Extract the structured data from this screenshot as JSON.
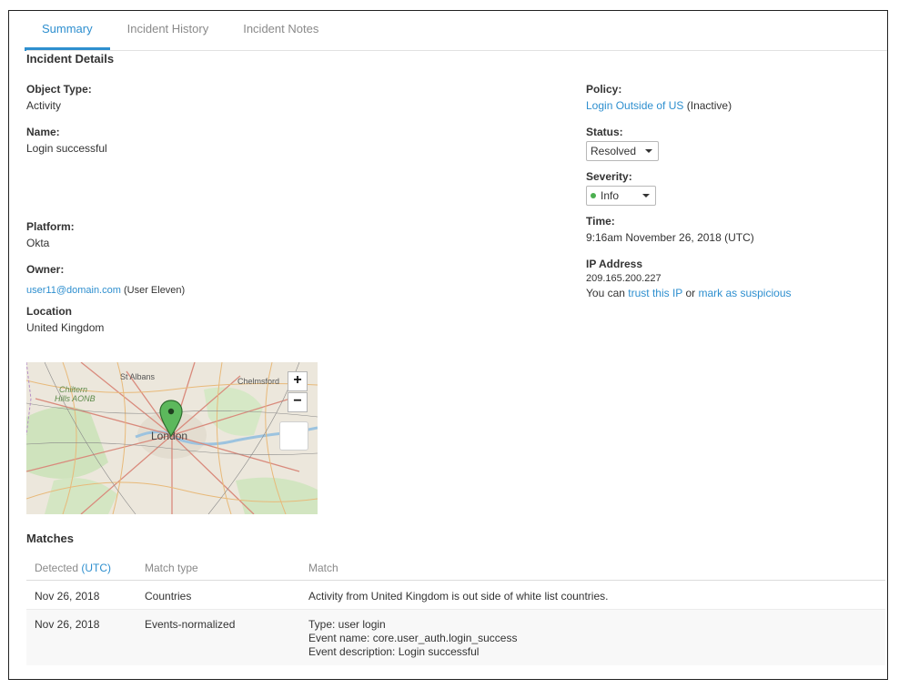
{
  "tabs": [
    {
      "label": "Summary",
      "active": true
    },
    {
      "label": "Incident History",
      "active": false
    },
    {
      "label": "Incident Notes",
      "active": false
    }
  ],
  "incident_details": {
    "title": "Incident Details",
    "object_type": {
      "label": "Object Type:",
      "value": "Activity"
    },
    "name": {
      "label": "Name:",
      "value": "Login successful"
    },
    "platform": {
      "label": "Platform:",
      "value": "Okta"
    },
    "owner": {
      "label": "Owner:",
      "email": "user11@domain.com",
      "display_name": "(User Eleven)"
    },
    "location": {
      "label": "Location",
      "value": "United Kingdom"
    },
    "policy": {
      "label": "Policy:",
      "link": "Login Outside of US",
      "state": "(Inactive)"
    },
    "status": {
      "label": "Status:",
      "value": "Resolved"
    },
    "severity": {
      "label": "Severity:",
      "value": "Info",
      "dot_color": "#4caf50"
    },
    "time": {
      "label": "Time:",
      "value": "9:16am November 26, 2018 (UTC)"
    },
    "ip": {
      "label": "IP Address",
      "value": "209.165.200.227",
      "prefix": "You can",
      "trust_link": "trust this IP",
      "or_text": "or",
      "suspicious_link": "mark as suspicious"
    }
  },
  "map": {
    "labels": {
      "st_albans": "St Albans",
      "chelmsford": "Chelmsford",
      "chiltern": "Chiltern",
      "hills_aonb": "Hills AONB",
      "london": "London"
    },
    "zoom_in": "+",
    "zoom_out": "−",
    "marker_color": "#5cb85c"
  },
  "matches": {
    "title": "Matches",
    "headers": {
      "detected": "Detected",
      "utc": "(UTC)",
      "match_type": "Match type",
      "match": "Match"
    },
    "rows": [
      {
        "detected": "Nov 26, 2018",
        "type": "Countries",
        "lines": [
          "Activity from United Kingdom is out side of white list countries."
        ]
      },
      {
        "detected": "Nov 26, 2018",
        "type": "Events-normalized",
        "lines": [
          "Type: user login",
          "Event name: core.user_auth.login_success",
          "Event description: Login successful"
        ]
      }
    ]
  },
  "colors": {
    "accent": "#2e8fcf",
    "text": "#333333",
    "muted": "#8a8a8a"
  }
}
